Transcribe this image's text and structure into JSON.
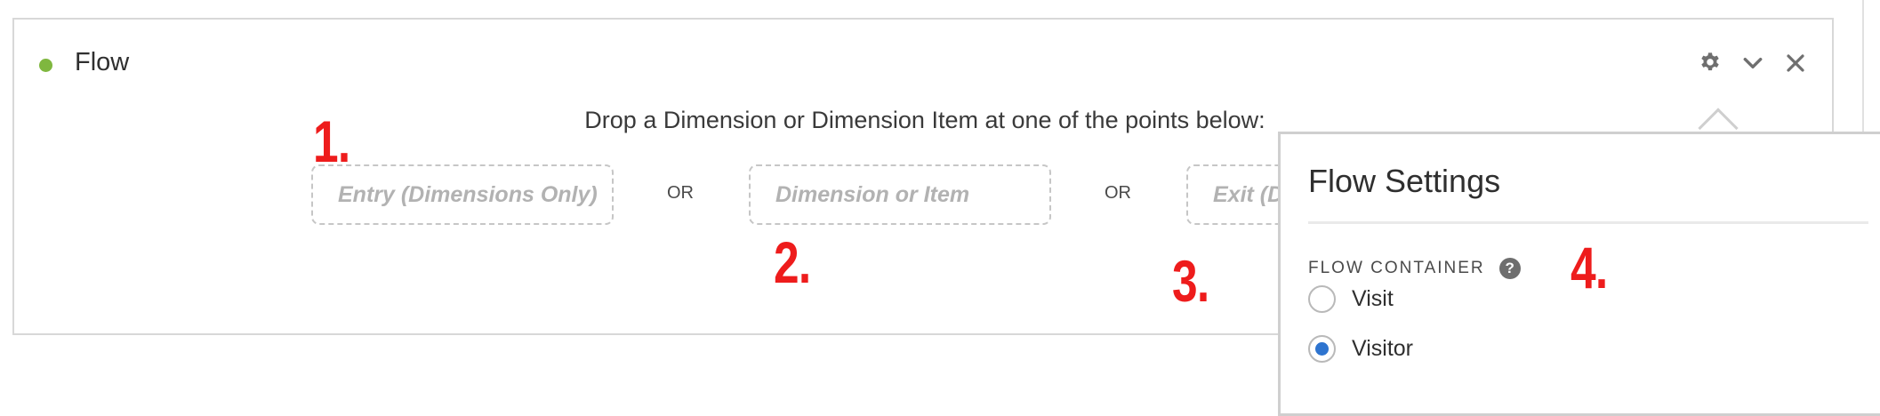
{
  "panel": {
    "title": "Flow",
    "status_color": "#7fb73f",
    "actions": [
      "gear-icon",
      "chevron-down-icon",
      "close-icon"
    ],
    "instruction": "Drop a Dimension or Dimension Item at one of the points below:"
  },
  "drop_zones": {
    "entry_placeholder": "Entry (Dimensions Only)",
    "middle_placeholder": "Dimension or Item",
    "exit_placeholder": "Exit (D",
    "separator": "OR"
  },
  "annotations": {
    "n1": "1.",
    "n2": "2.",
    "n3": "3.",
    "n4": "4.",
    "color": "#ee1c1c"
  },
  "settings_popover": {
    "title": "Flow Settings",
    "container_label": "FLOW CONTAINER",
    "help_glyph": "?",
    "options": [
      {
        "label": "Visit",
        "selected": false
      },
      {
        "label": "Visitor",
        "selected": true
      }
    ],
    "accent_color": "#2e74cf"
  }
}
